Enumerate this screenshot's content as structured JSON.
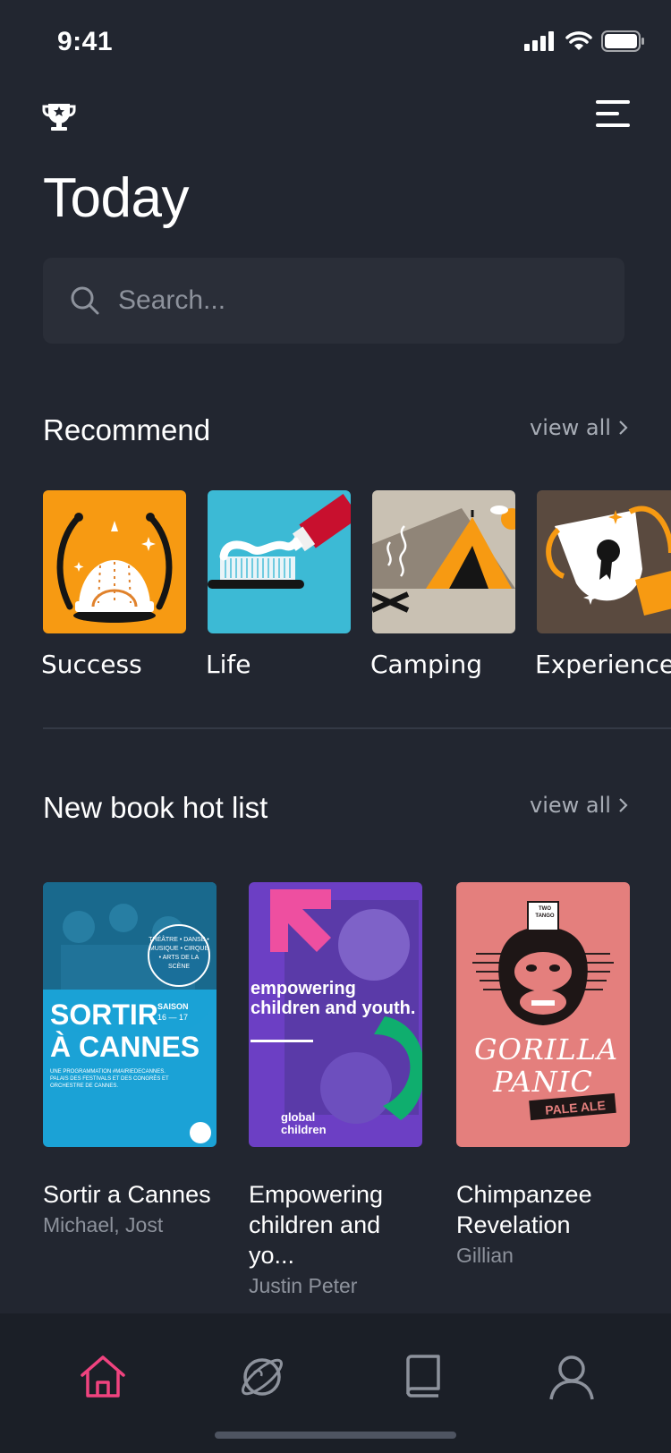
{
  "status": {
    "time": "9:41"
  },
  "header": {
    "title": "Today"
  },
  "search": {
    "placeholder": "Search..."
  },
  "recommend": {
    "title": "Recommend",
    "view_all": "view all",
    "items": [
      {
        "label": "Success"
      },
      {
        "label": "Life"
      },
      {
        "label": "Camping"
      },
      {
        "label": "Experience"
      }
    ]
  },
  "hotlist": {
    "title": "New book hot list",
    "view_all": "view all",
    "books": [
      {
        "title": "Sortir a Cannes",
        "author": "Michael, Jost",
        "cover": {
          "line1": "SORTIR",
          "line2": "À CANNES",
          "season": "SAISON",
          "years": "16 — 17",
          "badge": "THÉÂTRE • DANSE • MUSIQUE • CIRQUE • ARTS DE LA SCÈNE",
          "subtext": "UNE PROGRAMMATION #MAIRIEDECANNES. PALAIS DES FESTIVALS ET DES CONGRÈS ET ORCHESTRE DE CANNES."
        }
      },
      {
        "title": "Empowering children and yo...",
        "author": "Justin Peter",
        "cover": {
          "headline": "empowering children and youth.",
          "logo": "global children"
        }
      },
      {
        "title": "Chimpanzee Revelation",
        "author": "Gillian",
        "cover": {
          "brand": "TWO TANGO",
          "line1": "GORILLA",
          "line2": "PANIC",
          "tag": "PALE ALE"
        }
      }
    ]
  },
  "tabs": [
    {
      "name": "home",
      "icon": "home-icon",
      "active": true
    },
    {
      "name": "discover",
      "icon": "planet-icon",
      "active": false
    },
    {
      "name": "library",
      "icon": "book-icon",
      "active": false
    },
    {
      "name": "profile",
      "icon": "user-icon",
      "active": false
    }
  ],
  "colors": {
    "background": "#222630",
    "accent": "#f0437f",
    "muted": "#8d929c"
  }
}
